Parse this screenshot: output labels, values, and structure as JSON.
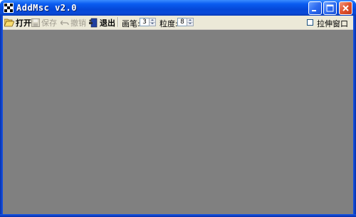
{
  "window": {
    "title": "AddMsc v2.0",
    "icon": "app-grid-icon"
  },
  "titlebar_buttons": {
    "minimize": "minimize-icon",
    "maximize": "maximize-icon",
    "close": "close-icon"
  },
  "toolbar": {
    "open_label": "打开",
    "save_label": "保存",
    "undo_label": "撤销",
    "exit_label": "退出",
    "brush_label": "画笔:",
    "brush_value": "3",
    "granularity_label": "粒度:",
    "granularity_value": "8",
    "stretch_label": "拉伸窗口",
    "stretch_checked": false
  },
  "colors": {
    "titlebar": "#0a5cf0",
    "client_bg": "#ece9d8",
    "canvas_bg": "#808080",
    "close_button": "#e0522c"
  }
}
